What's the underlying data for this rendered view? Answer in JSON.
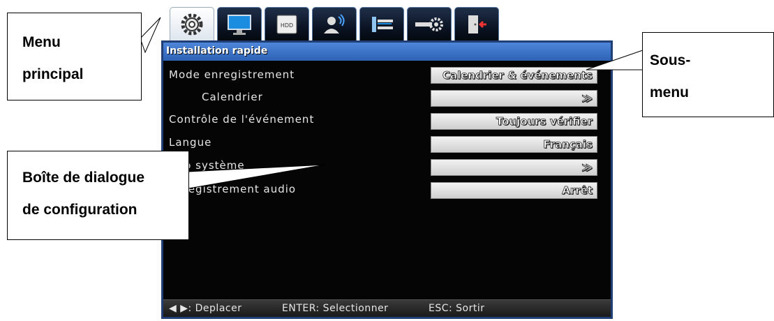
{
  "tabs": [
    {
      "icon": "gear-icon",
      "active": true
    },
    {
      "icon": "monitor-icon",
      "active": false
    },
    {
      "icon": "hdd-icon",
      "active": false,
      "label": "HDD"
    },
    {
      "icon": "user-network-icon",
      "active": false
    },
    {
      "icon": "network-icon",
      "active": false
    },
    {
      "icon": "system-tools-icon",
      "active": false
    },
    {
      "icon": "exit-icon",
      "active": false
    }
  ],
  "panel": {
    "title": "Installation rapide",
    "options": [
      {
        "label": "Mode enregistrement",
        "value": "Calendrier & événements"
      },
      {
        "label": "Calendrier",
        "value": "≫"
      },
      {
        "label": "Contrôle de l'événement",
        "value": "Toujours vérifier"
      },
      {
        "label": "Langue",
        "value": "Français"
      },
      {
        "label": "Info système",
        "value": "≫"
      },
      {
        "label": "Enregistrement audio",
        "value": "Arrêt"
      }
    ],
    "footer": {
      "move": "◀ ▶: Deplacer",
      "enter": "ENTER: Selectionner",
      "esc": "ESC: Sortir"
    }
  },
  "callouts": {
    "main_menu": [
      "Menu",
      "principal"
    ],
    "submenu": [
      "Sous-",
      "menu"
    ],
    "dialog": [
      "Boîte  de  dialogue",
      "de configuration"
    ]
  },
  "colors": {
    "title_bar": "#3a73c9",
    "panel_bg": "#050505",
    "value_box": "#d9d9d9"
  }
}
